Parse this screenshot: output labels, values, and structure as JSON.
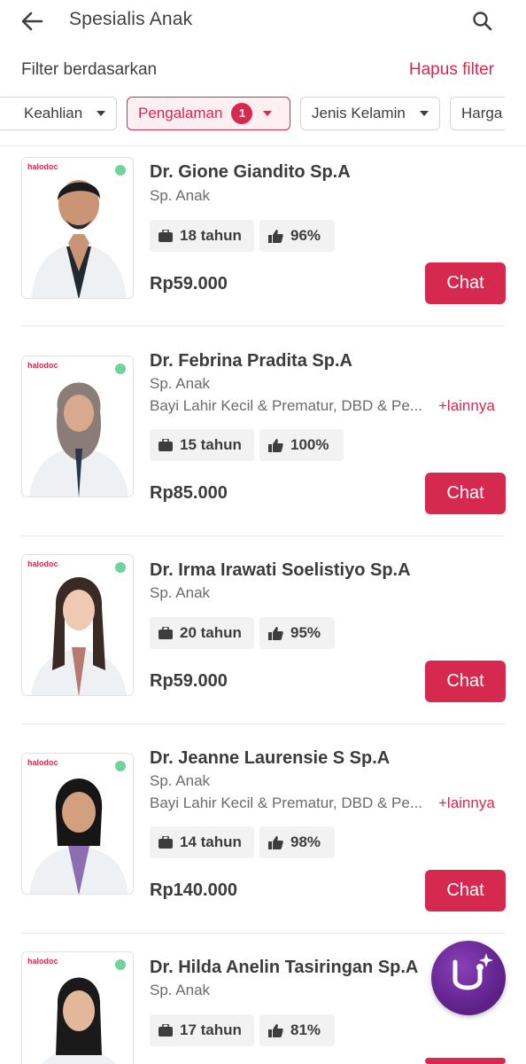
{
  "appbar": {
    "title": "Spesialis Anak"
  },
  "filter": {
    "label": "Filter berdasarkan",
    "clear": "Hapus filter",
    "chips": [
      {
        "label": "Keahlian",
        "active": false
      },
      {
        "label": "Pengalaman",
        "active": true,
        "badge": "1"
      },
      {
        "label": "Jenis Kelamin",
        "active": false
      },
      {
        "label": "Harga",
        "active": false
      }
    ]
  },
  "photo_brand": "halodoc",
  "doctors": [
    {
      "name": "Dr. Gione Giandito Sp.A",
      "spec": "Sp. Anak",
      "experience": "18 tahun",
      "rating": "96%",
      "price": "Rp59.000",
      "chat": "Chat",
      "online": true
    },
    {
      "name": "Dr. Febrina Pradita Sp.A",
      "spec": "Sp. Anak",
      "skills": "Bayi Lahir Kecil & Prematur, DBD & Pe...",
      "more": "+lainnya",
      "experience": "15 tahun",
      "rating": "100%",
      "price": "Rp85.000",
      "chat": "Chat",
      "online": true
    },
    {
      "name": "Dr. Irma Irawati Soelistiyo Sp.A",
      "spec": "Sp. Anak",
      "experience": "20 tahun",
      "rating": "95%",
      "price": "Rp59.000",
      "chat": "Chat",
      "online": true
    },
    {
      "name": "Dr. Jeanne Laurensie S Sp.A",
      "spec": "Sp. Anak",
      "skills": "Bayi Lahir Kecil & Prematur, DBD & Pe...",
      "more": "+lainnya",
      "experience": "14 tahun",
      "rating": "98%",
      "price": "Rp140.000",
      "chat": "Chat",
      "online": true
    },
    {
      "name": "Dr. Hilda Anelin Tasiringan Sp.A",
      "spec": "Sp. Anak",
      "experience": "17 tahun",
      "rating": "81%",
      "online": true
    }
  ],
  "icons": {
    "back": "arrow-left-icon",
    "search": "search-icon",
    "experience": "briefcase-icon",
    "rating": "thumbs-up-icon",
    "fab": "stethoscope-sparkle-icon"
  },
  "colors": {
    "accent": "#d6294f",
    "online": "#6fd39a",
    "fab": "#5b1f86"
  }
}
